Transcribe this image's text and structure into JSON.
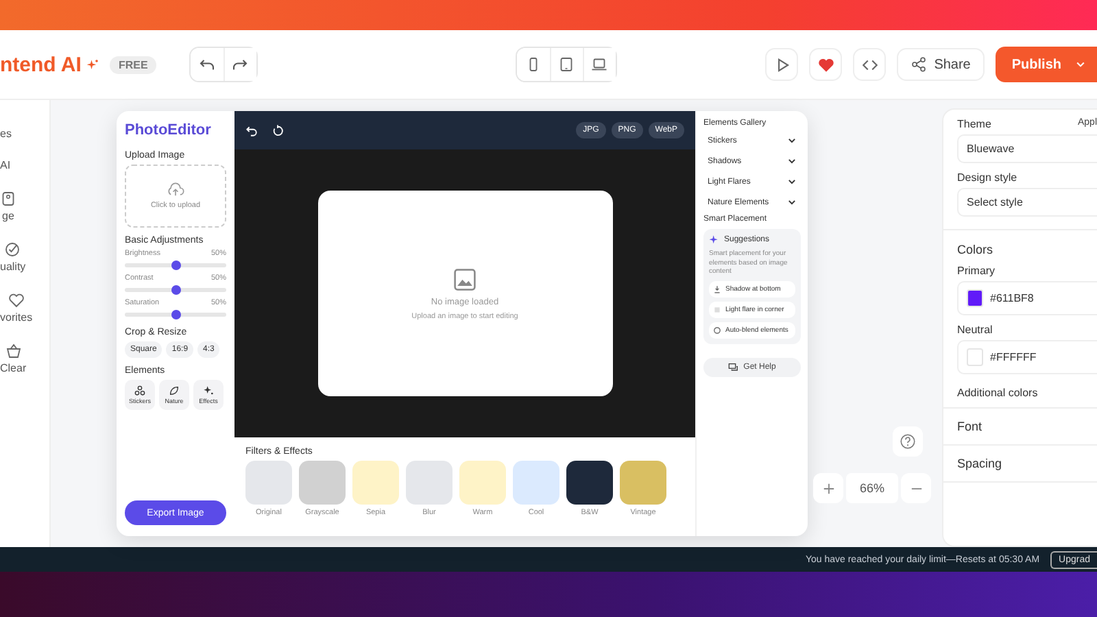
{
  "header": {
    "brand": "ntend AI",
    "badge": "FREE",
    "share": "Share",
    "publish": "Publish"
  },
  "sidebar": {
    "items": [
      {
        "label": "es"
      },
      {
        "label": "AI"
      },
      {
        "label": "ge"
      },
      {
        "label": "uality"
      },
      {
        "label": "vorites"
      },
      {
        "label": "Clear"
      }
    ]
  },
  "editor": {
    "title": "PhotoEditor",
    "upload": {
      "heading": "Upload Image",
      "hint": "Click to upload"
    },
    "adjustments": {
      "heading": "Basic Adjustments",
      "sliders": [
        {
          "name": "Brightness",
          "level": 0.5,
          "reading": "50%"
        },
        {
          "name": "Contrast",
          "level": 0.5,
          "reading": "50%"
        },
        {
          "name": "Saturation",
          "level": 0.5,
          "reading": "50%"
        }
      ]
    },
    "crop": {
      "heading": "Crop & Resize",
      "options": [
        "Square",
        "16:9",
        "4:3"
      ]
    },
    "elements": {
      "heading": "Elements",
      "tiles": [
        "Stickers",
        "Nature",
        "Effects"
      ]
    },
    "export_button": "Export Image",
    "formats": [
      "JPG",
      "PNG",
      "WebP"
    ],
    "canvas": {
      "title": "No image loaded",
      "hint": "Upload an image to start editing"
    },
    "filters": {
      "heading": "Filters & Effects",
      "items": [
        {
          "label": "Original",
          "color": "#e5e7eb"
        },
        {
          "label": "Grayscale",
          "color": "#d1d1d1"
        },
        {
          "label": "Sepia",
          "color": "#fef3c7"
        },
        {
          "label": "Blur",
          "color": "#e5e7eb"
        },
        {
          "label": "Warm",
          "color": "#fef3c7"
        },
        {
          "label": "Cool",
          "color": "#dbeafe"
        },
        {
          "label": "B&W",
          "color": "#1e293b"
        },
        {
          "label": "Vintage",
          "color": "#d9bf62"
        }
      ]
    },
    "gallery": {
      "heading": "Elements Gallery",
      "sections": [
        "Stickers",
        "Shadows",
        "Light Flares",
        "Nature Elements"
      ],
      "smart_placement": "Smart Placement",
      "suggestions": {
        "title": "Suggestions",
        "description": "Smart placement for your elements based on image content",
        "items": [
          "Shadow at bottom",
          "Light flare in corner",
          "Auto-blend elements"
        ]
      },
      "help_button": "Get Help"
    }
  },
  "zoom": {
    "level": "66%"
  },
  "settings": {
    "theme_label": "Theme",
    "apply": "Appl",
    "theme_value": "Bluewave",
    "design_label": "Design style",
    "design_placeholder": "Select style",
    "colors_heading": "Colors",
    "colors": [
      {
        "name": "Primary",
        "value": "#611BF8",
        "color": "#611bf8"
      },
      {
        "name": "Neutral",
        "value": "#FFFFFF",
        "color": "#ffffff"
      }
    ],
    "additional": "Additional colors",
    "sections": [
      "Font",
      "Spacing"
    ]
  },
  "status_bar": {
    "message": "You have reached your daily limit—Resets at 05:30 AM",
    "upgrade": "Upgrad"
  }
}
